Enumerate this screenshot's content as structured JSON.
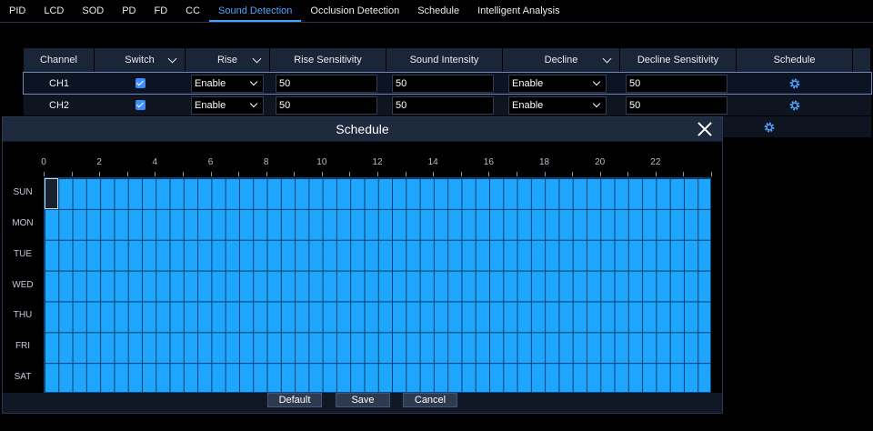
{
  "tabs": [
    {
      "label": "PID"
    },
    {
      "label": "LCD"
    },
    {
      "label": "SOD"
    },
    {
      "label": "PD"
    },
    {
      "label": "FD"
    },
    {
      "label": "CC"
    },
    {
      "label": "Sound Detection",
      "active": true
    },
    {
      "label": "Occlusion Detection"
    },
    {
      "label": "Schedule"
    },
    {
      "label": "Intelligent Analysis"
    }
  ],
  "table": {
    "headers": {
      "channel": "Channel",
      "switch": "Switch",
      "rise": "Rise",
      "rise_sensitivity": "Rise Sensitivity",
      "sound_intensity": "Sound Intensity",
      "decline": "Decline",
      "decline_sensitivity": "Decline Sensitivity",
      "schedule": "Schedule"
    },
    "rows": [
      {
        "channel": "CH1",
        "switch": true,
        "rise": "Enable",
        "rise_sensitivity": "50",
        "sound_intensity": "50",
        "decline": "Enable",
        "decline_sensitivity": "50",
        "selected": true
      },
      {
        "channel": "CH2",
        "switch": true,
        "rise": "Enable",
        "rise_sensitivity": "50",
        "sound_intensity": "50",
        "decline": "Enable",
        "decline_sensitivity": "50"
      }
    ]
  },
  "modal": {
    "title": "Schedule",
    "hour_labels": [
      "0",
      "2",
      "4",
      "6",
      "8",
      "10",
      "12",
      "14",
      "16",
      "18",
      "20",
      "22"
    ],
    "days": [
      "SUN",
      "MON",
      "TUE",
      "WED",
      "THU",
      "FRI",
      "SAT"
    ],
    "slots_per_day": 48,
    "all_scheduled": true,
    "buttons": {
      "default": "Default",
      "save": "Save",
      "cancel": "Cancel"
    }
  },
  "colors": {
    "accent": "#4ba3ff",
    "schedule_fill": "#1ea6ff",
    "checkbox": "#3f8cff"
  },
  "icons": {
    "schedule": "gear-icon",
    "close": "close-icon",
    "dropdown": "chevron-down-icon"
  }
}
